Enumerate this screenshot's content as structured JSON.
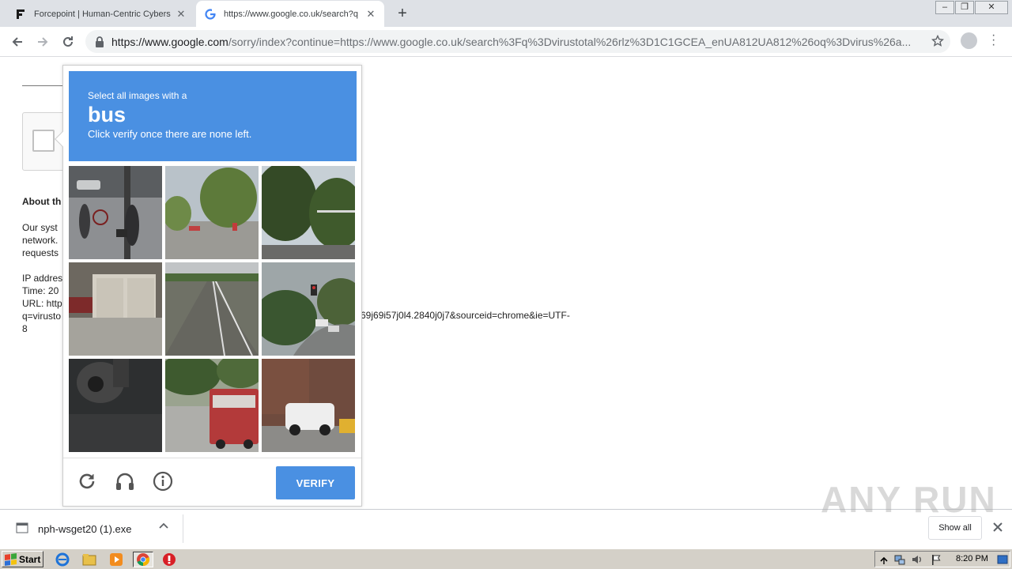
{
  "tabs": [
    {
      "title": "Forcepoint | Human-Centric Cyberse",
      "favicon": "forcepoint-icon",
      "active": false
    },
    {
      "title": "https://www.google.co.uk/search?q",
      "favicon": "google-icon",
      "active": true
    }
  ],
  "toolbar": {
    "url_host": "https://www.google.com",
    "url_rest": "/sorry/index?continue=https://www.google.co.uk/search%3Fq%3Dvirustotal%26rlz%3D1C1GCEA_enUA812UA812%26oq%3Dvirus%26a..."
  },
  "page": {
    "about_heading": "About th",
    "para1": [
      "Our syst",
      "network.",
      "requests"
    ],
    "para2": [
      "IP addres",
      "Time: 20",
      "URL: http",
      "q=virusto",
      "8"
    ],
    "tail_text": "69j69i57j0l4.2840j0j7&sourceid=chrome&ie=UTF-"
  },
  "captcha": {
    "instruction_line1": "Select all images with a",
    "target_word": "bus",
    "instruction_line3": "Click verify once there are none left.",
    "verify_label": "VERIFY",
    "accent_color": "#4a90e2",
    "icons": [
      "reload-icon",
      "audio-challenge-icon",
      "info-icon"
    ]
  },
  "downloads": {
    "file_name": "nph-wsget20 (1).exe",
    "show_all_label": "Show all"
  },
  "watermark": "ANY RUN",
  "taskbar": {
    "start_label": "Start",
    "clock": "8:20 PM"
  }
}
